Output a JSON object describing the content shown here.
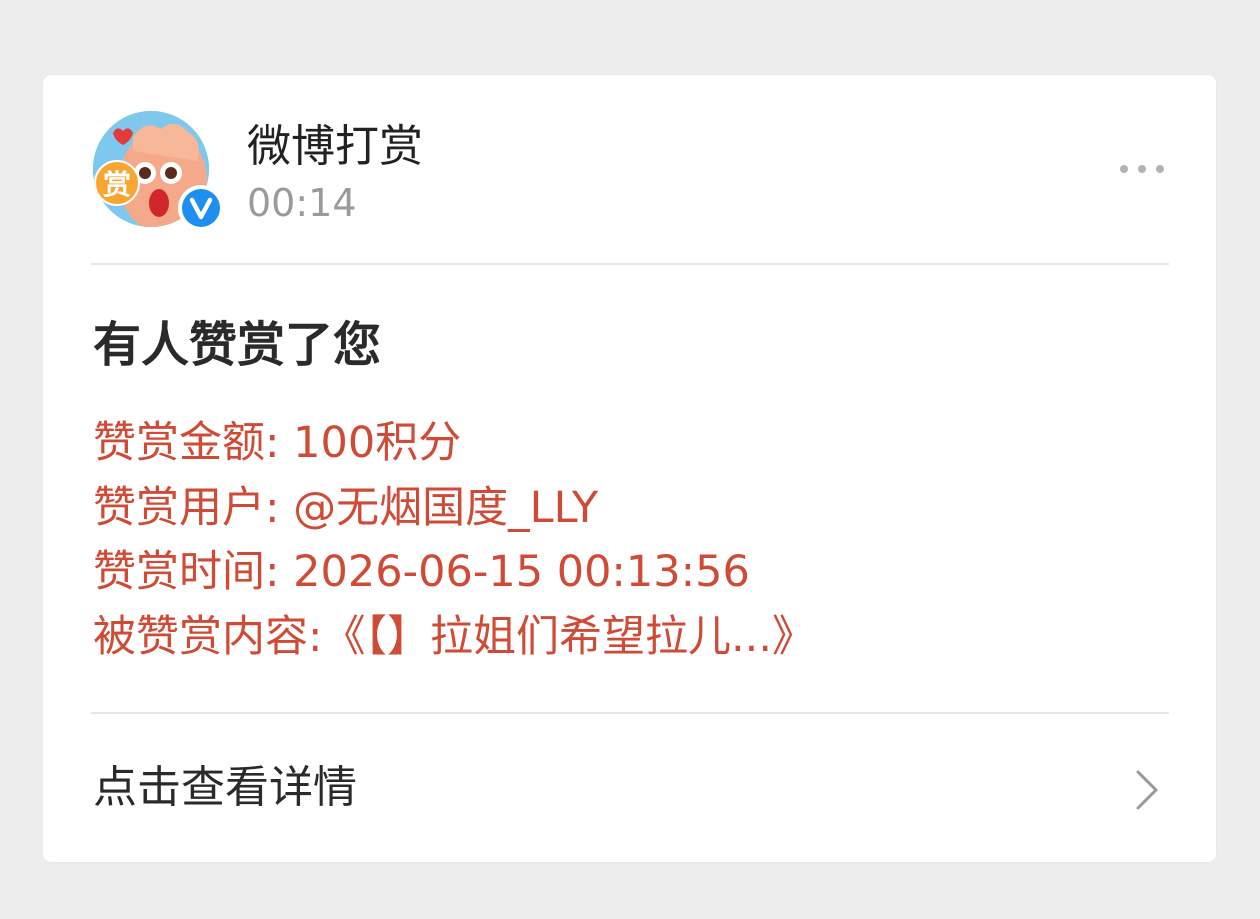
{
  "sender": {
    "name": "微博打赏",
    "time": "00:14",
    "avatar_badge_text": "赏",
    "verified_badge": "V"
  },
  "message": {
    "title": "有人赞赏了您",
    "details": [
      "赞赏金额: 100积分",
      "赞赏用户: @无烟国度_LLY",
      "赞赏时间: 2026-06-15 00:13:56",
      "被赞赏内容:《【】拉姐们希望拉儿...》"
    ]
  },
  "footer": {
    "label": "点击查看详情"
  },
  "icons": {
    "more": "more-horizontal-icon",
    "chevron": "chevron-right-icon",
    "verified": "verified-badge-icon"
  },
  "colors": {
    "background": "#ededed",
    "card": "#ffffff",
    "detail_text": "#cf4b36",
    "time_text": "#9a9a9a",
    "verified_blue": "#1e8ff0"
  }
}
